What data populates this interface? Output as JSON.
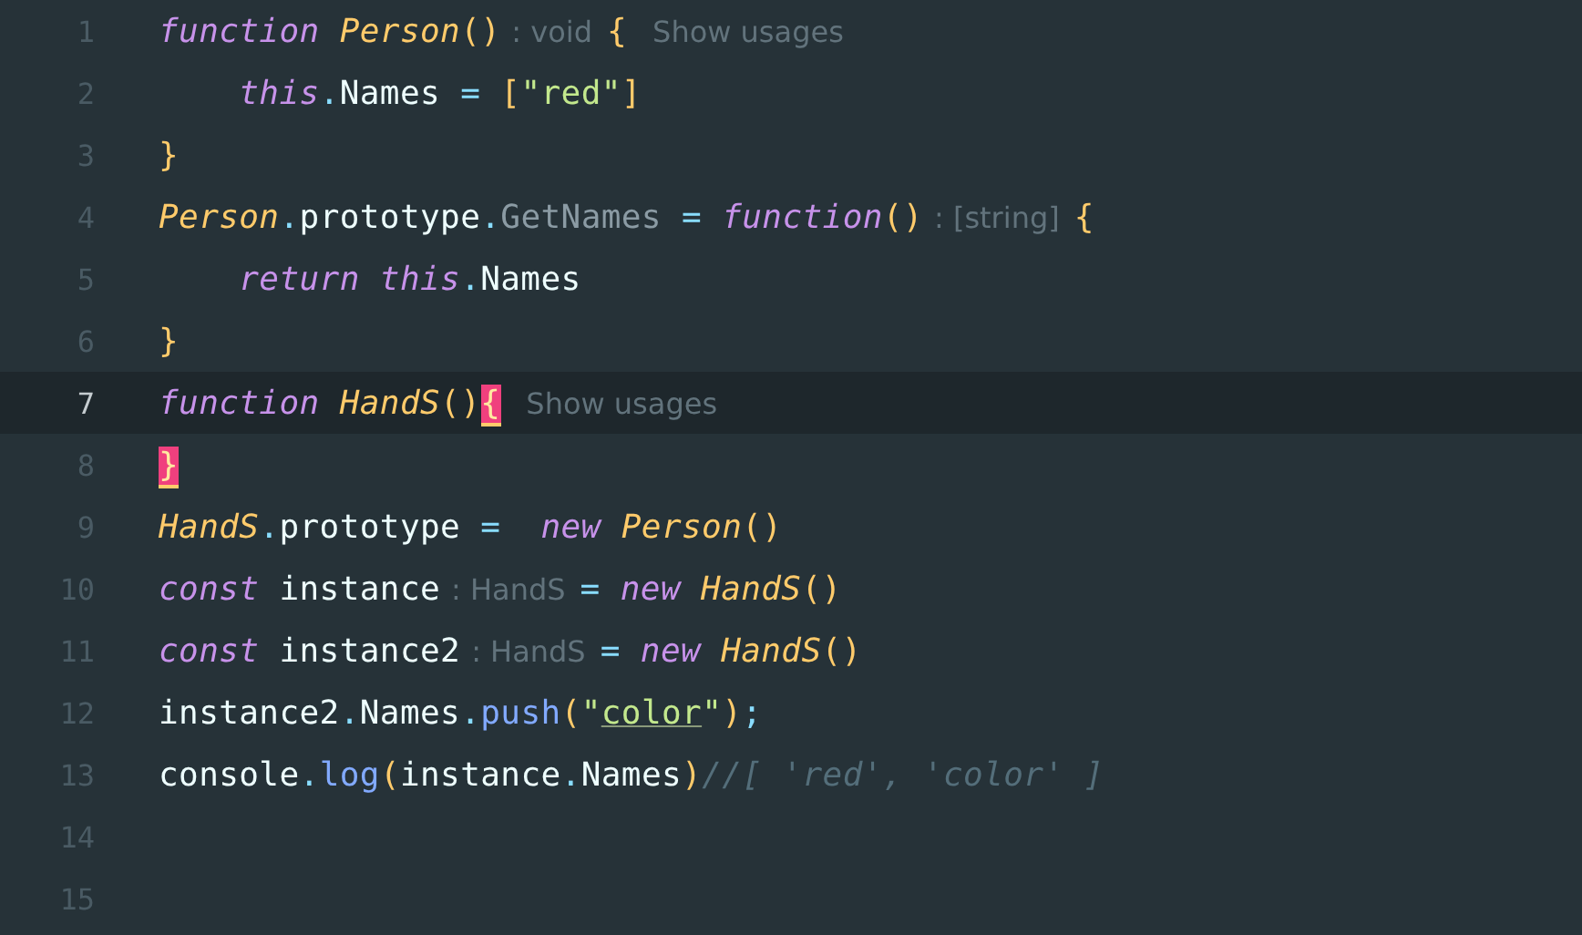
{
  "editor": {
    "lines": [
      {
        "number": "1",
        "current": false,
        "segments": [
          {
            "kind": "code",
            "tokens": [
              {
                "text": "function",
                "kind": "keyword"
              },
              {
                "text": " Person",
                "kind": "function"
              },
              {
                "text": "()",
                "kind": "paren"
              }
            ]
          },
          {
            "kind": "hint",
            "text": ": void"
          },
          {
            "kind": "code",
            "tokens": [
              {
                "text": "{",
                "kind": "paren"
              }
            ]
          },
          {
            "kind": "usages",
            "text": "Show usages"
          }
        ]
      },
      {
        "number": "2",
        "current": false,
        "segments": [
          {
            "kind": "code",
            "tokens": [
              {
                "text": "    this",
                "kind": "keyword"
              },
              {
                "text": ".",
                "kind": "operator"
              },
              {
                "text": "Names",
                "kind": "plain"
              },
              {
                "text": " = ",
                "kind": "operator"
              },
              {
                "text": "[",
                "kind": "paren"
              },
              {
                "text": "\"red\"",
                "kind": "string"
              },
              {
                "text": "]",
                "kind": "paren"
              }
            ]
          }
        ]
      },
      {
        "number": "3",
        "current": false,
        "segments": [
          {
            "kind": "code",
            "tokens": [
              {
                "text": "}",
                "kind": "paren"
              }
            ]
          }
        ]
      },
      {
        "number": "4",
        "current": false,
        "segments": [
          {
            "kind": "code",
            "tokens": [
              {
                "text": "Person",
                "kind": "function"
              },
              {
                "text": ".",
                "kind": "operator"
              },
              {
                "text": "prototype",
                "kind": "plain"
              },
              {
                "text": ".",
                "kind": "operator"
              },
              {
                "text": "GetNames",
                "kind": "property"
              },
              {
                "text": " = ",
                "kind": "operator"
              },
              {
                "text": "function",
                "kind": "keyword"
              },
              {
                "text": "()",
                "kind": "paren"
              }
            ]
          },
          {
            "kind": "hint",
            "text": ": [string]"
          },
          {
            "kind": "code",
            "tokens": [
              {
                "text": "{",
                "kind": "paren"
              }
            ]
          }
        ]
      },
      {
        "number": "5",
        "current": false,
        "segments": [
          {
            "kind": "code",
            "tokens": [
              {
                "text": "    return this",
                "kind": "keyword"
              },
              {
                "text": ".",
                "kind": "operator"
              },
              {
                "text": "Names",
                "kind": "plain"
              }
            ]
          }
        ]
      },
      {
        "number": "6",
        "current": false,
        "segments": [
          {
            "kind": "code",
            "tokens": [
              {
                "text": "}",
                "kind": "paren"
              }
            ]
          }
        ]
      },
      {
        "number": "7",
        "current": true,
        "segments": [
          {
            "kind": "code",
            "tokens": [
              {
                "text": "function",
                "kind": "keyword"
              },
              {
                "text": " HandS",
                "kind": "function"
              },
              {
                "text": "()",
                "kind": "paren"
              },
              {
                "text": "{",
                "kind": "brace-match"
              }
            ]
          },
          {
            "kind": "usages",
            "text": "Show usages"
          }
        ]
      },
      {
        "number": "8",
        "current": false,
        "segments": [
          {
            "kind": "code",
            "tokens": [
              {
                "text": "}",
                "kind": "brace-match"
              }
            ]
          }
        ]
      },
      {
        "number": "9",
        "current": false,
        "segments": [
          {
            "kind": "code",
            "tokens": [
              {
                "text": "HandS",
                "kind": "function"
              },
              {
                "text": ".",
                "kind": "operator"
              },
              {
                "text": "prototype",
                "kind": "plain"
              },
              {
                "text": " =  ",
                "kind": "operator"
              },
              {
                "text": "new",
                "kind": "keyword"
              },
              {
                "text": " Person",
                "kind": "function"
              },
              {
                "text": "()",
                "kind": "paren"
              }
            ]
          }
        ]
      },
      {
        "number": "10",
        "current": false,
        "segments": [
          {
            "kind": "code",
            "tokens": [
              {
                "text": "const",
                "kind": "keyword"
              },
              {
                "text": " instance",
                "kind": "plain"
              }
            ]
          },
          {
            "kind": "hint",
            "text": ": HandS"
          },
          {
            "kind": "code",
            "tokens": [
              {
                "text": "= ",
                "kind": "operator"
              },
              {
                "text": "new",
                "kind": "keyword"
              },
              {
                "text": " HandS",
                "kind": "function"
              },
              {
                "text": "()",
                "kind": "paren"
              }
            ]
          }
        ]
      },
      {
        "number": "11",
        "current": false,
        "segments": [
          {
            "kind": "code",
            "tokens": [
              {
                "text": "const",
                "kind": "keyword"
              },
              {
                "text": " instance2",
                "kind": "plain"
              }
            ]
          },
          {
            "kind": "hint",
            "text": ": HandS"
          },
          {
            "kind": "code",
            "tokens": [
              {
                "text": "= ",
                "kind": "operator"
              },
              {
                "text": "new",
                "kind": "keyword"
              },
              {
                "text": " HandS",
                "kind": "function"
              },
              {
                "text": "()",
                "kind": "paren"
              }
            ]
          }
        ]
      },
      {
        "number": "12",
        "current": false,
        "segments": [
          {
            "kind": "code",
            "tokens": [
              {
                "text": "instance2",
                "kind": "plain"
              },
              {
                "text": ".",
                "kind": "operator"
              },
              {
                "text": "Names",
                "kind": "plain"
              },
              {
                "text": ".",
                "kind": "operator"
              },
              {
                "text": "push",
                "kind": "method"
              },
              {
                "text": "(",
                "kind": "paren"
              },
              {
                "text": "\"",
                "kind": "string"
              },
              {
                "text": "color",
                "kind": "string-underlined"
              },
              {
                "text": "\"",
                "kind": "string"
              },
              {
                "text": ")",
                "kind": "paren"
              },
              {
                "text": ";",
                "kind": "operator"
              }
            ]
          }
        ]
      },
      {
        "number": "13",
        "current": false,
        "segments": [
          {
            "kind": "code",
            "tokens": [
              {
                "text": "console",
                "kind": "plain"
              },
              {
                "text": ".",
                "kind": "operator"
              },
              {
                "text": "log",
                "kind": "method"
              },
              {
                "text": "(",
                "kind": "paren"
              },
              {
                "text": "instance",
                "kind": "plain"
              },
              {
                "text": ".",
                "kind": "operator"
              },
              {
                "text": "Names",
                "kind": "plain"
              },
              {
                "text": ")",
                "kind": "paren"
              },
              {
                "text": "//[ 'red', 'color' ]",
                "kind": "comment"
              }
            ]
          }
        ]
      },
      {
        "number": "14",
        "current": false
      },
      {
        "number": "15",
        "current": false
      }
    ]
  }
}
